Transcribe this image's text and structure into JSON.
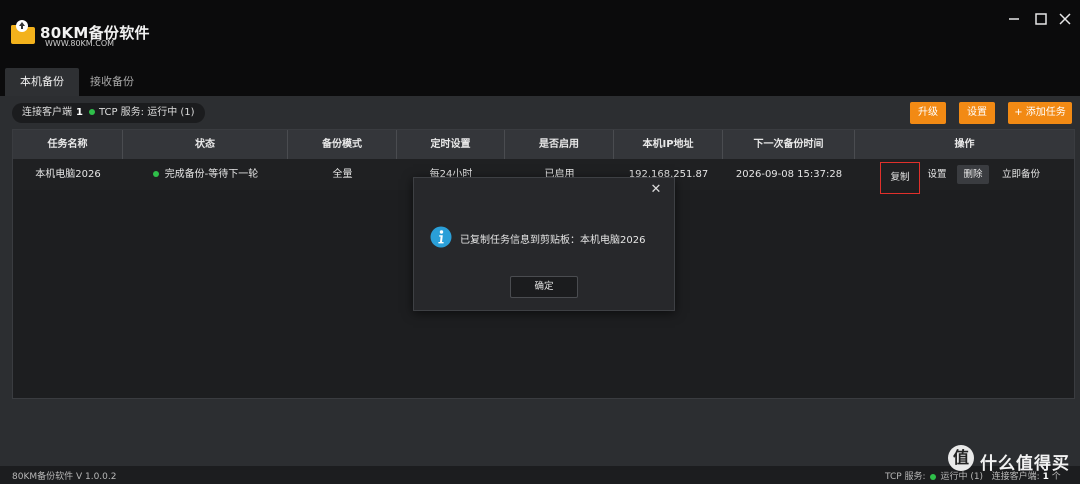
{
  "app": {
    "name": "80KM备份软件",
    "url": "WWW.80KM.COM"
  },
  "tabs": [
    {
      "label": "本机备份",
      "active": true
    },
    {
      "label": "接收备份",
      "active": false
    }
  ],
  "status_bar": {
    "clients_label": "连接客户端",
    "clients_count": "1",
    "tcp_label": "TCP 服务: 运行中 (1)"
  },
  "toolbar": {
    "upgrade_label": "升级",
    "settings_label": "设置",
    "add_task_label": "+ 添加任务"
  },
  "table": {
    "headers": [
      "任务名称",
      "状态",
      "备份模式",
      "定时设置",
      "是否启用",
      "本机IP地址",
      "下一次备份时间",
      "操作"
    ],
    "rows": [
      {
        "name": "本机电脑2026",
        "status": "完成备份-等待下一轮",
        "mode": "全量",
        "schedule": "每24小时",
        "enabled": "已启用",
        "ip": "192.168.251.87",
        "next_time": "2026-09-08 15:37:28",
        "actions": {
          "copy": "复制",
          "settings": "设置",
          "delete": "删除",
          "backup_now": "立即备份"
        }
      }
    ]
  },
  "dialog": {
    "message": "已复制任务信息到剪贴板：本机电脑2026",
    "ok_label": "确定",
    "close_glyph": "✕"
  },
  "footer": {
    "version": "80KM备份软件 V 1.0.0.2",
    "tcp_label": "TCP 服务:",
    "tcp_status": "运行中 (1)",
    "clients_label": "连接客户端:",
    "clients_count": "1",
    "clients_suffix": "个"
  },
  "watermark": {
    "badge": "值",
    "text": "什么值得买"
  },
  "colors": {
    "accent_orange": "#f28a14",
    "status_green": "#2fbf4a",
    "highlight_red": "#e0302b",
    "info_blue": "#2a9fd8"
  }
}
